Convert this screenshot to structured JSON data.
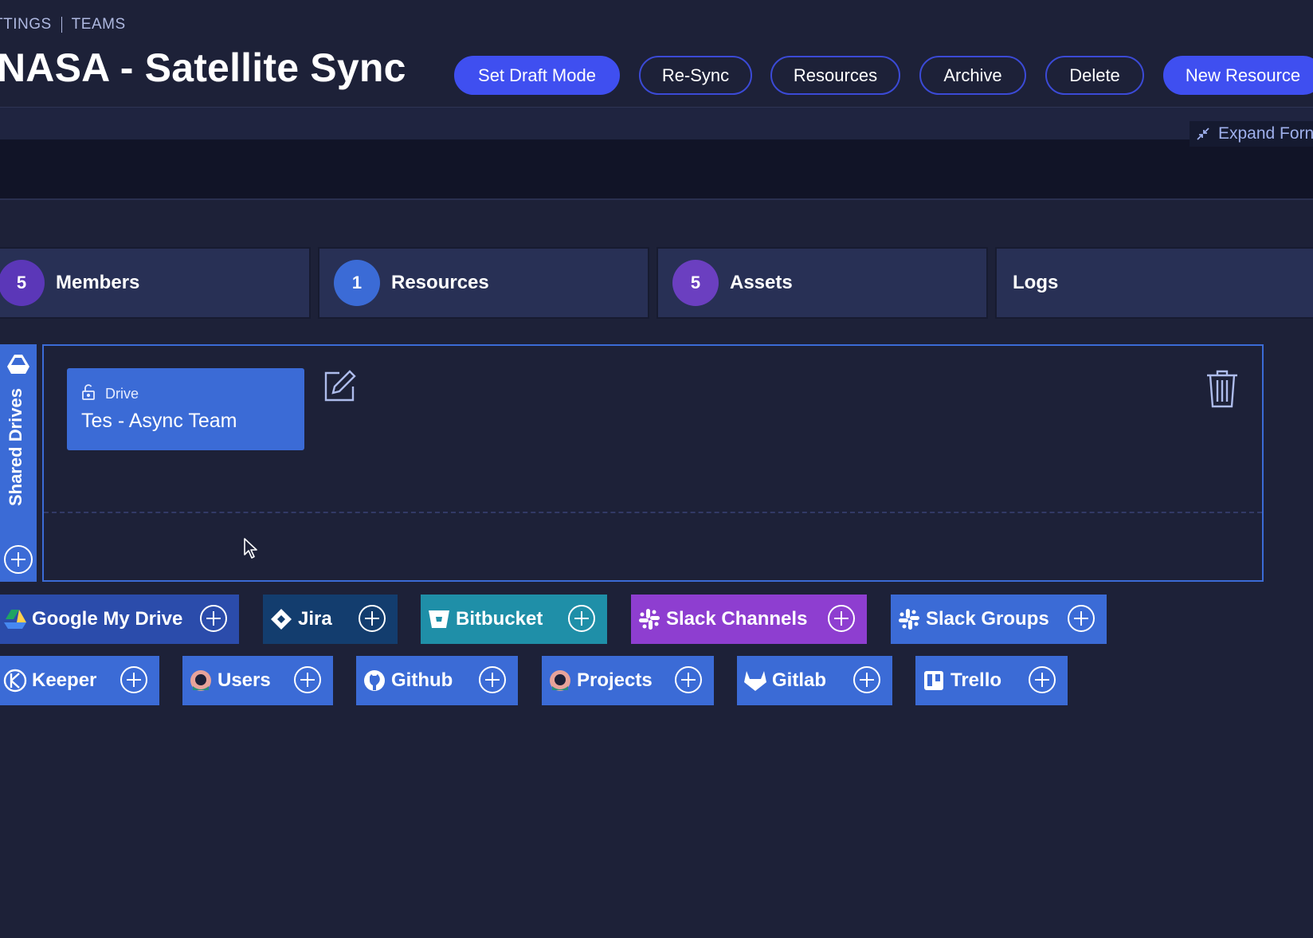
{
  "breadcrumb": {
    "parent": "TTINGS",
    "current": "TEAMS"
  },
  "page_title": "NASA - Satellite Sync",
  "actions": {
    "set_draft_mode": "Set Draft Mode",
    "re_sync": "Re-Sync",
    "resources": "Resources",
    "archive": "Archive",
    "delete": "Delete",
    "new_resource": "New Resource"
  },
  "expand_form": "Expand Forn",
  "tabs": [
    {
      "count": "5",
      "label": "Members",
      "color": "#5b37b8"
    },
    {
      "count": "1",
      "label": "Resources",
      "color": "#3b6bd6"
    },
    {
      "count": "5",
      "label": "Assets",
      "color": "#6b3fc0"
    },
    {
      "count": "",
      "label": "Logs",
      "color": ""
    }
  ],
  "side_tab": {
    "label": "Shared Drives"
  },
  "drive_card": {
    "type": "Drive",
    "name": "Tes - Async Team"
  },
  "integrations_row1": [
    {
      "label": "Google My Drive",
      "icon": "google-drive-icon",
      "color": "#2b4cab"
    },
    {
      "label": "Jira",
      "icon": "jira-icon",
      "color": "#133d6e"
    },
    {
      "label": "Bitbucket",
      "icon": "bitbucket-icon",
      "color": "#1f8fa8"
    },
    {
      "label": "Slack Channels",
      "icon": "slack-icon",
      "color": "#8e3ed0"
    },
    {
      "label": "Slack Groups",
      "icon": "slack-icon",
      "color": "#3b6bd6"
    }
  ],
  "integrations_row2": [
    {
      "label": "Keeper",
      "icon": "keeper-icon",
      "color": "#3b6bd6"
    },
    {
      "label": "Users",
      "icon": "users-icon",
      "color": "#3b6bd6"
    },
    {
      "label": "Github",
      "icon": "github-icon",
      "color": "#3b6bd6"
    },
    {
      "label": "Projects",
      "icon": "projects-icon",
      "color": "#3b6bd6"
    },
    {
      "label": "Gitlab",
      "icon": "gitlab-icon",
      "color": "#3b6bd6"
    },
    {
      "label": "Trello",
      "icon": "trello-icon",
      "color": "#3b6bd6"
    }
  ]
}
